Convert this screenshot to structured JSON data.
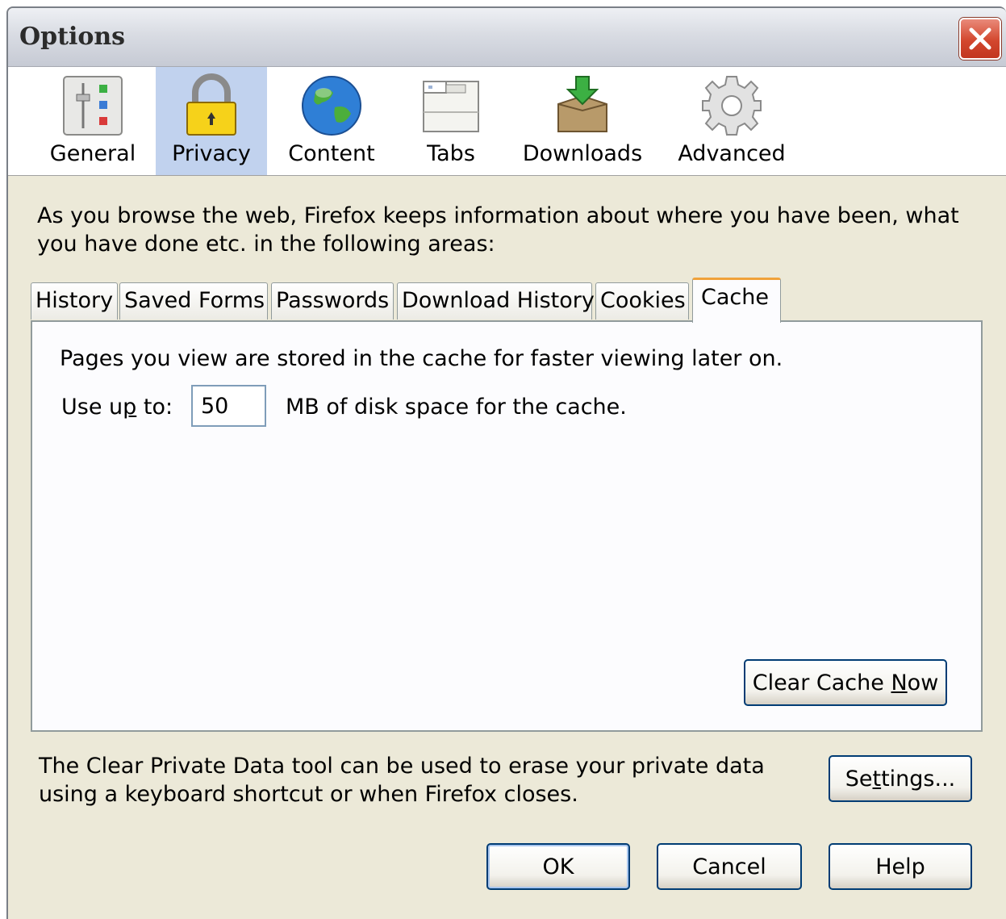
{
  "window": {
    "title": "Options"
  },
  "panes": [
    {
      "label": "General",
      "icon": "general-sliders-icon"
    },
    {
      "label": "Privacy",
      "icon": "padlock-icon",
      "selected": true
    },
    {
      "label": "Content",
      "icon": "globe-icon"
    },
    {
      "label": "Tabs",
      "icon": "tabs-window-icon"
    },
    {
      "label": "Downloads",
      "icon": "download-box-icon"
    },
    {
      "label": "Advanced",
      "icon": "gear-icon"
    }
  ],
  "privacy": {
    "intro": "As you browse the web, Firefox keeps information about where you have been, what you have done etc. in the following areas:",
    "tabs": [
      "History",
      "Saved Forms",
      "Passwords",
      "Download History",
      "Cookies",
      "Cache"
    ],
    "active_tab": "Cache",
    "cache": {
      "description": "Pages you view are stored in the cache for faster viewing later on.",
      "use_up_to_pre": "Use u",
      "use_up_to_key": "p",
      "use_up_to_post": " to:",
      "size_value": "50",
      "size_suffix": "MB of disk space for the cache.",
      "clear_pre": "Clear Cache ",
      "clear_key": "N",
      "clear_post": "ow"
    },
    "private_data_text": "The Clear Private Data tool can be used to erase your private data using a keyboard shortcut or when Firefox closes.",
    "settings_pre": "Se",
    "settings_key": "t",
    "settings_post": "tings..."
  },
  "buttons": {
    "ok": "OK",
    "cancel": "Cancel",
    "help": "Help"
  },
  "colors": {
    "selected_pane": "#c1d2ee",
    "active_tab_accent": "#f0a23a",
    "button_border": "#003c74",
    "close_red": "#d3472e"
  }
}
